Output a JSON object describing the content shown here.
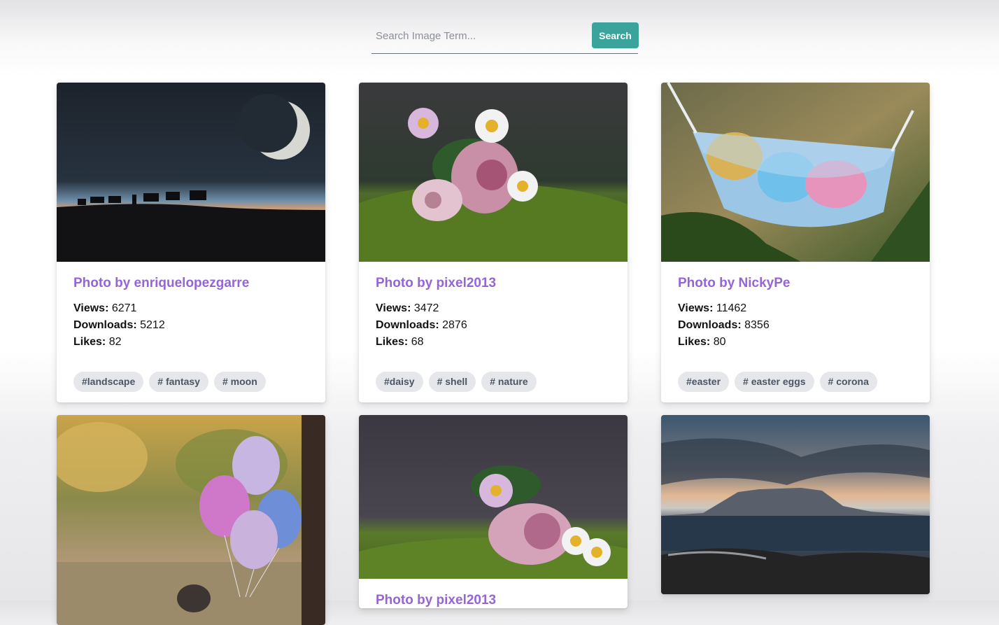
{
  "search": {
    "placeholder": "Search Image Term...",
    "button_label": "Search"
  },
  "cards": [
    {
      "title": "Photo by enriquelopezgarre",
      "image_subject": "camel caravan under crescent moon",
      "stats": {
        "views_label": "Views:",
        "views": "6271",
        "downloads_label": "Downloads:",
        "downloads": "5212",
        "likes_label": "Likes:",
        "likes": "82"
      },
      "tags": [
        "#landscape",
        "# fantasy",
        "# moon"
      ]
    },
    {
      "title": "Photo by pixel2013",
      "image_subject": "daisies in sea shells on moss",
      "stats": {
        "views_label": "Views:",
        "views": "3472",
        "downloads_label": "Downloads:",
        "downloads": "2876",
        "likes_label": "Likes:",
        "likes": "68"
      },
      "tags": [
        "#daisy",
        "# shell",
        "# nature"
      ]
    },
    {
      "title": "Photo by NickyPe",
      "image_subject": "easter eggs in face mask",
      "stats": {
        "views_label": "Views:",
        "views": "11462",
        "downloads_label": "Downloads:",
        "downloads": "8356",
        "likes_label": "Likes:",
        "likes": "80"
      },
      "tags": [
        "#easter",
        "# easter eggs",
        "# corona"
      ]
    },
    {
      "title": "",
      "image_subject": "child holding balloons by a lake",
      "stats": {},
      "tags": []
    },
    {
      "title": "Photo by pixel2013",
      "image_subject": "daisies in a sea shell on moss",
      "stats": {},
      "tags": []
    },
    {
      "title": "",
      "image_subject": "table mountain sunset over sea",
      "stats": {},
      "tags": []
    }
  ]
}
